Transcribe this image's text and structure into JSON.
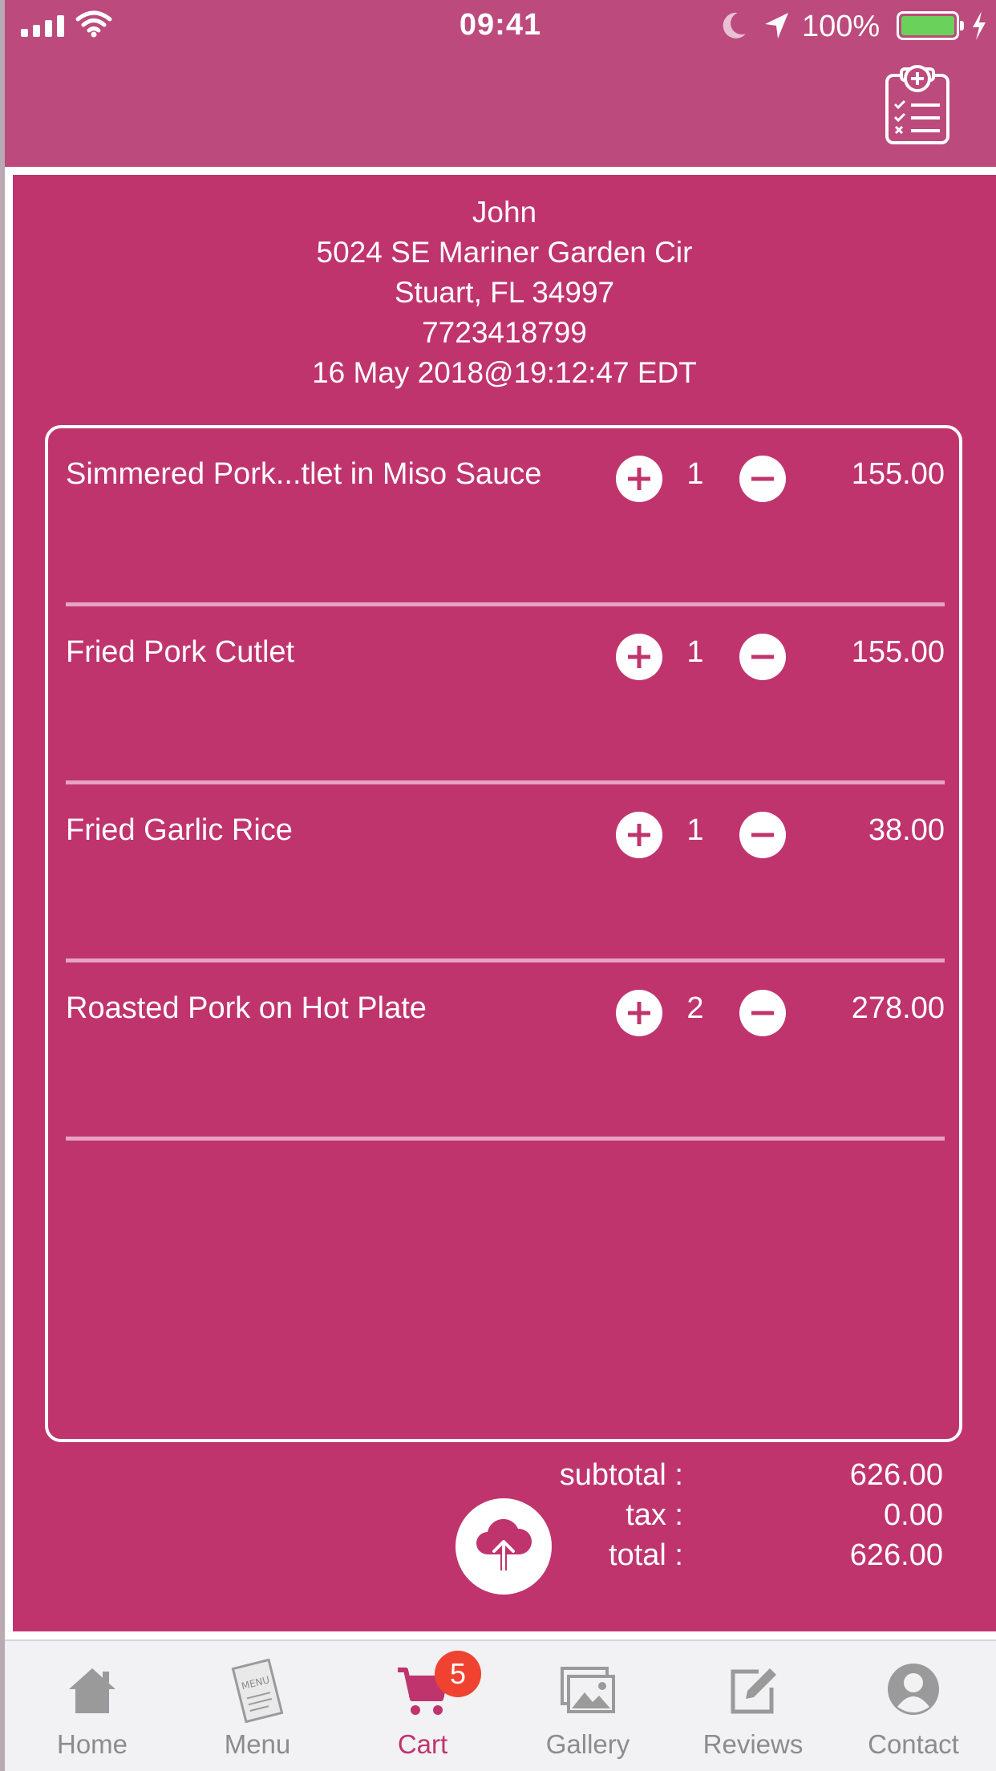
{
  "colors": {
    "header_bg": "#bc4a7c",
    "content_bg": "#c0346e",
    "divider": "#e7a3c2",
    "tab_active": "#c0346e",
    "tab_inactive": "#8c8c8c",
    "badge": "#f04230",
    "battery": "#6ad15a"
  },
  "status_bar": {
    "time": "09:41",
    "battery_percent": "100%",
    "icons": [
      "signal-icon",
      "wifi-icon",
      "moon-icon",
      "location-arrow-icon",
      "battery-icon",
      "charging-bolt-icon"
    ]
  },
  "header": {
    "action_icon": "order-checklist-add-icon"
  },
  "customer": {
    "name": "John",
    "street": "5024 SE Mariner Garden Cir",
    "city_line": "Stuart, FL 34997",
    "phone": "7723418799",
    "datetime": "16 May 2018@19:12:47 EDT"
  },
  "cart": {
    "items": [
      {
        "name": "Simmered Pork...tlet in Miso Sauce",
        "qty": "1",
        "price": "155.00"
      },
      {
        "name": "Fried Pork Cutlet",
        "qty": "1",
        "price": "155.00"
      },
      {
        "name": "Fried Garlic Rice",
        "qty": "1",
        "price": "38.00"
      },
      {
        "name": "Roasted Pork on Hot Plate",
        "qty": "2",
        "price": "278.00"
      }
    ]
  },
  "totals": {
    "subtotal_label": "subtotal :",
    "subtotal": "626.00",
    "tax_label": "tax :",
    "tax": "0.00",
    "total_label": "total :",
    "total": "626.00"
  },
  "submit_icon": "cloud-upload-icon",
  "tabbar": {
    "tabs": [
      {
        "label": "Home",
        "icon": "home-icon"
      },
      {
        "label": "Menu",
        "icon": "menu-book-icon"
      },
      {
        "label": "Cart",
        "icon": "cart-icon",
        "badge": "5",
        "active": true
      },
      {
        "label": "Gallery",
        "icon": "gallery-icon"
      },
      {
        "label": "Reviews",
        "icon": "edit-review-icon"
      },
      {
        "label": "Contact",
        "icon": "contact-person-icon"
      }
    ]
  }
}
